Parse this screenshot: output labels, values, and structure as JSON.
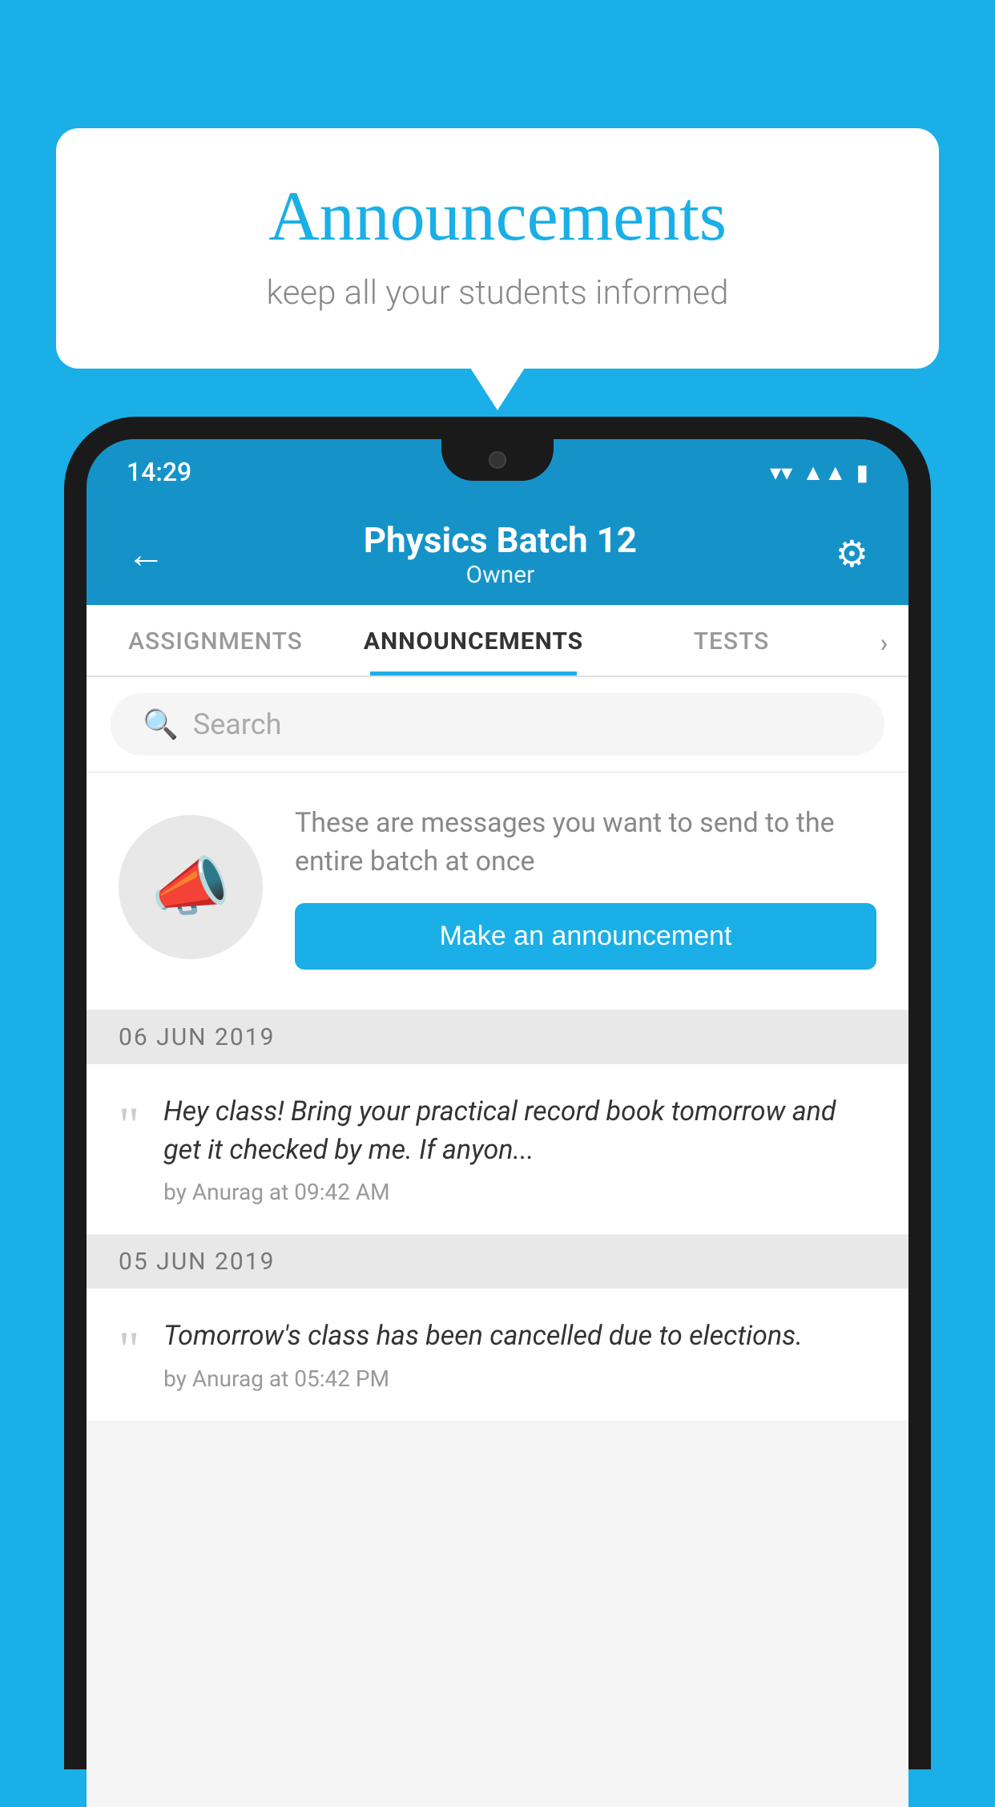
{
  "background_color": "#1AAFE6",
  "speech_bubble": {
    "title": "Announcements",
    "subtitle": "keep all your students informed"
  },
  "phone": {
    "status_bar": {
      "time": "14:29",
      "icons": [
        "wifi",
        "signal",
        "battery"
      ]
    },
    "header": {
      "back_label": "←",
      "title": "Physics Batch 12",
      "subtitle": "Owner",
      "gear_label": "⚙"
    },
    "tabs": [
      {
        "label": "ASSIGNMENTS",
        "active": false
      },
      {
        "label": "ANNOUNCEMENTS",
        "active": true
      },
      {
        "label": "TESTS",
        "active": false
      },
      {
        "label": "›",
        "active": false
      }
    ],
    "search": {
      "placeholder": "Search"
    },
    "promo_card": {
      "description": "These are messages you want to send to the entire batch at once",
      "button_label": "Make an announcement"
    },
    "announcements": [
      {
        "date": "06  JUN  2019",
        "text": "Hey class! Bring your practical record book tomorrow and get it checked by me. If anyon...",
        "meta": "by Anurag at 09:42 AM"
      },
      {
        "date": "05  JUN  2019",
        "text": "Tomorrow's class has been cancelled due to elections.",
        "meta": "by Anurag at 05:42 PM"
      }
    ]
  }
}
